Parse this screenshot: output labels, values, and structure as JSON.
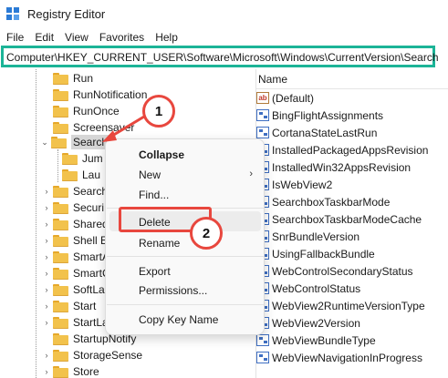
{
  "window": {
    "title": "Registry Editor",
    "app_icon": "registry-editor-icon"
  },
  "menu": [
    "File",
    "Edit",
    "View",
    "Favorites",
    "Help"
  ],
  "address": {
    "path": "Computer\\HKEY_CURRENT_USER\\Software\\Microsoft\\Windows\\CurrentVersion\\Search"
  },
  "tree": {
    "items": [
      {
        "label": "Run",
        "expander": ""
      },
      {
        "label": "RunNotification",
        "expander": ""
      },
      {
        "label": "RunOnce",
        "expander": ""
      },
      {
        "label": "Screensaver",
        "expander": ""
      },
      {
        "label": "Search",
        "expander": "expanded",
        "selected": true
      },
      {
        "label": "Jum",
        "expander": ""
      },
      {
        "label": "Lau",
        "expander": ""
      },
      {
        "label": "Search",
        "expander": "collapsed"
      },
      {
        "label": "Securi",
        "expander": "collapsed"
      },
      {
        "label": "Shared",
        "expander": "collapsed"
      },
      {
        "label": "Shell E",
        "expander": "collapsed"
      },
      {
        "label": "SmartA",
        "expander": "collapsed"
      },
      {
        "label": "SmartC",
        "expander": "collapsed"
      },
      {
        "label": "SoftLa",
        "expander": "collapsed"
      },
      {
        "label": "Start",
        "expander": "collapsed"
      },
      {
        "label": "StartLa",
        "expander": "collapsed"
      },
      {
        "label": "StartupNotify",
        "expander": ""
      },
      {
        "label": "StorageSense",
        "expander": "collapsed"
      },
      {
        "label": "Store",
        "expander": "collapsed"
      }
    ]
  },
  "values_pane": {
    "column_name": "Name",
    "items": [
      {
        "name": "(Default)",
        "icon": "string-value-icon"
      },
      {
        "name": "BingFlightAssignments",
        "icon": "binary-value-icon"
      },
      {
        "name": "CortanaStateLastRun",
        "icon": "binary-value-icon"
      },
      {
        "name": "InstalledPackagedAppsRevision",
        "icon": "binary-value-icon"
      },
      {
        "name": "InstalledWin32AppsRevision",
        "icon": "binary-value-icon"
      },
      {
        "name": "IsWebView2",
        "icon": "binary-value-icon"
      },
      {
        "name": "SearchboxTaskbarMode",
        "icon": "binary-value-icon"
      },
      {
        "name": "SearchboxTaskbarModeCache",
        "icon": "binary-value-icon"
      },
      {
        "name": "SnrBundleVersion",
        "icon": "binary-value-icon"
      },
      {
        "name": "UsingFallbackBundle",
        "icon": "binary-value-icon"
      },
      {
        "name": "WebControlSecondaryStatus",
        "icon": "binary-value-icon"
      },
      {
        "name": "WebControlStatus",
        "icon": "binary-value-icon"
      },
      {
        "name": "WebView2RuntimeVersionType",
        "icon": "binary-value-icon"
      },
      {
        "name": "WebView2Version",
        "icon": "binary-value-icon"
      },
      {
        "name": "WebViewBundleType",
        "icon": "binary-value-icon"
      },
      {
        "name": "WebViewNavigationInProgress",
        "icon": "binary-value-icon"
      }
    ]
  },
  "context_menu": {
    "collapse": "Collapse",
    "new": "New",
    "find": "Find...",
    "delete": "Delete",
    "rename": "Rename",
    "export": "Export",
    "permissions": "Permissions...",
    "copy_key_name": "Copy Key Name"
  },
  "callouts": {
    "step1": "1",
    "step2": "2"
  },
  "colors": {
    "address_highlight": "#1cb497",
    "annotation_red": "#e8473e",
    "folder": "#f2c24c"
  }
}
